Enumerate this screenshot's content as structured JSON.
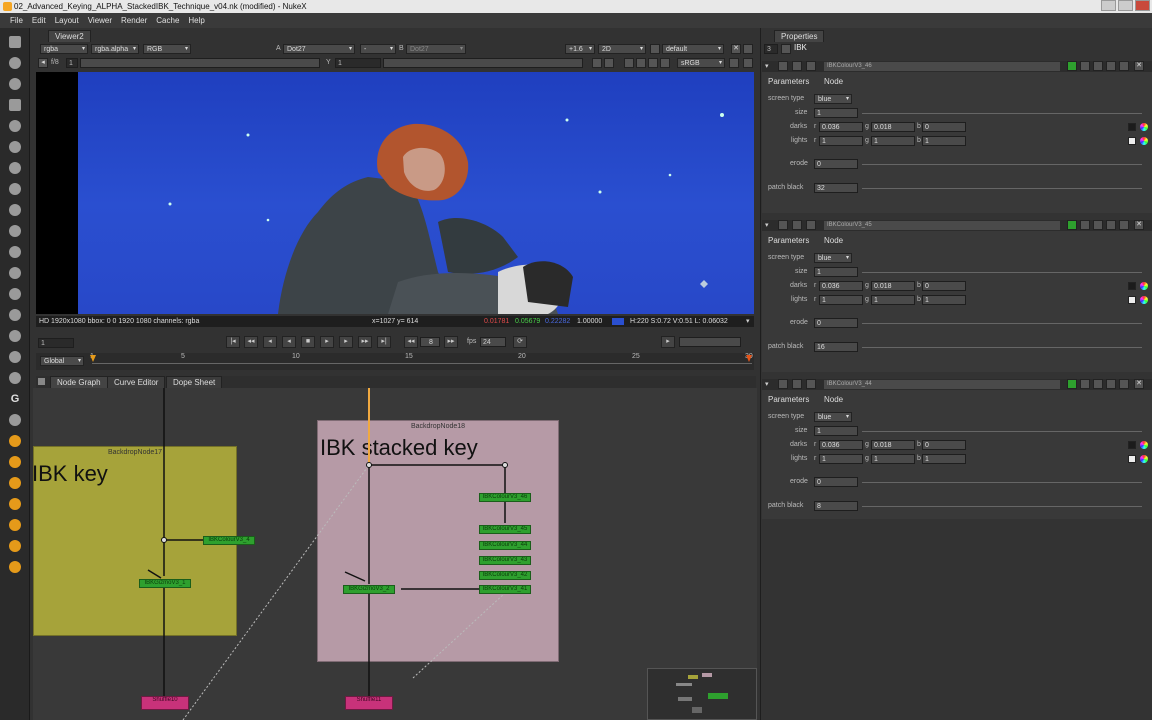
{
  "window": {
    "title": "02_Advanced_Keying_ALPHA_StackedIBK_Technique_v04.nk (modified) - NukeX"
  },
  "menu": [
    "File",
    "Edit",
    "Layout",
    "Viewer",
    "Render",
    "Cache",
    "Help"
  ],
  "viewer": {
    "tab": "Viewer2",
    "channels": "rgba",
    "alpha": "rgba.alpha",
    "colorspace": "RGB",
    "input_a_label": "A",
    "input_a": "Dot27",
    "input_b_op": "-",
    "input_b_label": "B",
    "input_b": "Dot27",
    "gain": "+1.6",
    "mode": "2D",
    "lut_default": "default",
    "frame_label": "f/8",
    "frame_value": "1",
    "y_label": "Y",
    "y_value": "1",
    "lut": "sRGB",
    "info_left": "HD 1920x1080  bbox: 0 0 1920 1080  channels: rgba",
    "info_xy": "x=1027 y= 614",
    "info_r": "0.01781",
    "info_g": "0.05679",
    "info_b": "0.22282",
    "info_a": "1.00000",
    "info_hsv": "H:220 S:0.72 V:0.51  L: 0.06032"
  },
  "transport": {
    "frame": "1",
    "frame_step": "8",
    "fps_label": "fps",
    "fps": "24"
  },
  "timeline": {
    "mode": "Global",
    "start": "1",
    "ticks": [
      "5",
      "10",
      "15",
      "20",
      "25",
      "30"
    ]
  },
  "nodegraph": {
    "tabs": [
      "Node Graph",
      "Curve Editor",
      "Dope Sheet"
    ],
    "backdrop1": {
      "title": "BackdropNode17",
      "label": "IBK key",
      "color": "#a6a33a"
    },
    "backdrop2": {
      "title": "BackdropNode18",
      "label": "IBK stacked key",
      "color": "#b69aa6"
    },
    "nodes": {
      "ibk_colour_a": "IBKColourV3_4",
      "ibk_gizmo_a": "IBKGizmoV3_1",
      "ibk_colour_46": "IBKColourV3_46",
      "ibk_colour_45": "IBKColourV3_45",
      "ibk_colour_44": "IBKColourV3_44",
      "ibk_colour_43": "IBKColourV3_43",
      "ibk_colour_42": "IBKColourV3_42",
      "ibk_colour_41": "IBKColourV3_41",
      "ibk_gizmo_b": "IBKGizmoV3_2",
      "shuffle10": "Shuffle10",
      "shuffle11": "Shuffle11"
    }
  },
  "properties": {
    "tab": "Properties",
    "max_panels": "3",
    "panels": [
      {
        "name": "IBKColourV3_46",
        "tab_params": "Parameters",
        "tab_node": "Node",
        "screen_type_label": "screen type",
        "screen_type": "blue",
        "size_label": "size",
        "size": "1",
        "darks_label": "darks",
        "darks_r": "0.036",
        "darks_g": "0.018",
        "darks_b": "0",
        "lights_label": "lights",
        "lights_r": "1",
        "lights_g": "1",
        "lights_b": "1",
        "erode_label": "erode",
        "erode": "0",
        "patch_label": "patch black",
        "patch_black": "32"
      },
      {
        "name": "IBKColourV3_45",
        "tab_params": "Parameters",
        "tab_node": "Node",
        "screen_type_label": "screen type",
        "screen_type": "blue",
        "size_label": "size",
        "size": "1",
        "darks_label": "darks",
        "darks_r": "0.036",
        "darks_g": "0.018",
        "darks_b": "0",
        "lights_label": "lights",
        "lights_r": "1",
        "lights_g": "1",
        "lights_b": "1",
        "erode_label": "erode",
        "erode": "0",
        "patch_label": "patch black",
        "patch_black": "16"
      },
      {
        "name": "IBKColourV3_44",
        "tab_params": "Parameters",
        "tab_node": "Node",
        "screen_type_label": "screen type",
        "screen_type": "blue",
        "size_label": "size",
        "size": "1",
        "darks_label": "darks",
        "darks_r": "0.036",
        "darks_g": "0.018",
        "darks_b": "0",
        "lights_label": "lights",
        "lights_r": "1",
        "lights_g": "1",
        "lights_b": "1",
        "erode_label": "erode",
        "erode": "0",
        "patch_label": "patch black",
        "patch_black": "8"
      }
    ]
  }
}
